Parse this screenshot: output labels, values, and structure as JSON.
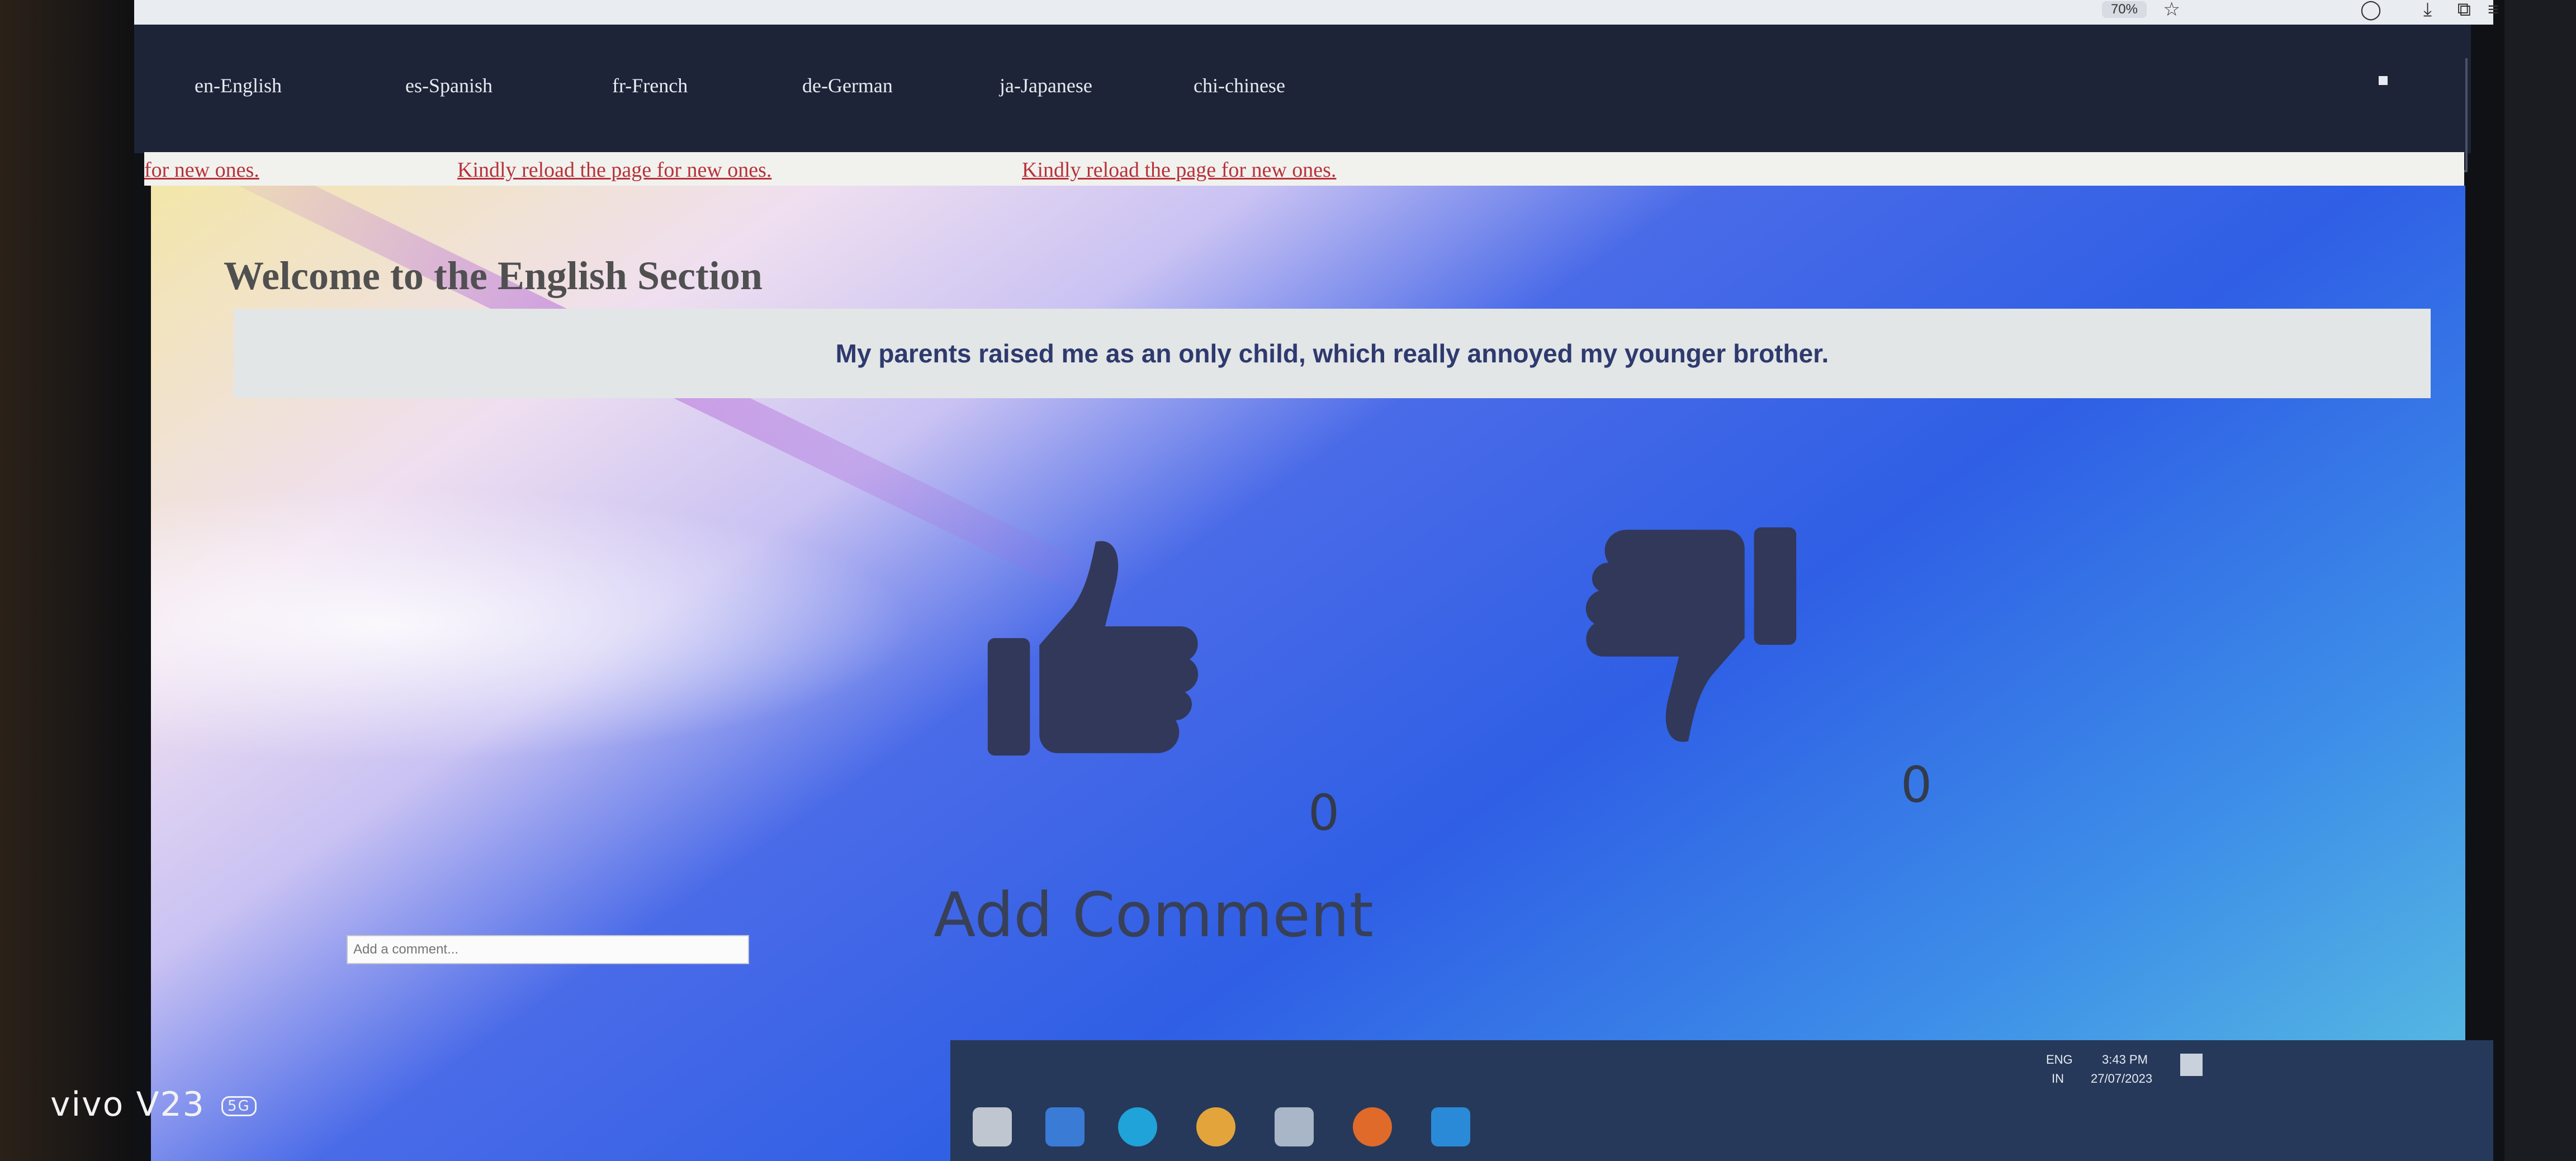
{
  "nav": {
    "items": [
      {
        "label": "en-English"
      },
      {
        "label": "es-Spanish"
      },
      {
        "label": "fr-French"
      },
      {
        "label": "de-German"
      },
      {
        "label": "ja-Japanese"
      },
      {
        "label": "chi-chinese"
      }
    ]
  },
  "browser": {
    "zoom": "70%"
  },
  "marquee": {
    "items": [
      "for new ones.",
      "Kindly reload the page for new ones.",
      "Kindly reload the page for new ones."
    ]
  },
  "main": {
    "title": "Welcome to the English Section",
    "quote": "My parents raised me as an only child, which really annoyed my younger brother.",
    "likes": "0",
    "dislikes": "0",
    "add_comment_label": "Add Comment",
    "comment_placeholder": "Add a comment..."
  },
  "taskbar": {
    "lang": "ENG",
    "region": "IN",
    "time": "3:43 PM",
    "date": "27/07/2023"
  },
  "watermark": {
    "device": "vivo V23",
    "badge": "5G"
  },
  "colors": {
    "navbar": "#1d2437",
    "quote_text": "#2e3a6e",
    "marquee_text": "#b8323b",
    "thumb_fill": "#32385a"
  }
}
